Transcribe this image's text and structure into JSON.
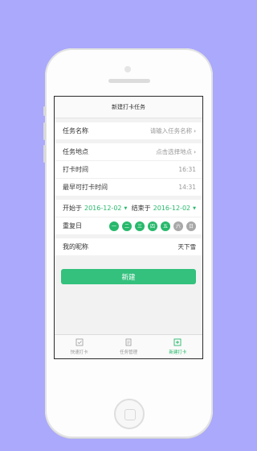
{
  "header": {
    "title": "新建打卡任务"
  },
  "form": {
    "task_name": {
      "label": "任务名称",
      "placeholder": "请输入任务名称"
    },
    "task_location": {
      "label": "任务地点",
      "placeholder": "点击选择地点"
    },
    "checkin_time": {
      "label": "打卡时间",
      "value": "16:31"
    },
    "earliest_time": {
      "label": "最早可打卡时间",
      "value": "14:31"
    },
    "start": {
      "label": "开始于",
      "value": "2016-12-02"
    },
    "end": {
      "label": "结束于",
      "value": "2016-12-02"
    },
    "repeat": {
      "label": "重复日",
      "days": [
        {
          "label": "一",
          "selected": true
        },
        {
          "label": "二",
          "selected": true
        },
        {
          "label": "三",
          "selected": true
        },
        {
          "label": "四",
          "selected": true
        },
        {
          "label": "五",
          "selected": true
        },
        {
          "label": "六",
          "selected": false
        },
        {
          "label": "日",
          "selected": false
        }
      ]
    },
    "nickname": {
      "label": "我的昵称",
      "value": "天下雪"
    }
  },
  "create_button": {
    "label": "新建"
  },
  "tabs": [
    {
      "label": "快速打卡",
      "icon": "check-icon",
      "active": false
    },
    {
      "label": "任务管理",
      "icon": "doc-icon",
      "active": false
    },
    {
      "label": "新建打卡",
      "icon": "plus-icon",
      "active": true
    }
  ],
  "colors": {
    "accent": "#27b96b",
    "button": "#33c17d",
    "background": "#aaa9fb"
  }
}
